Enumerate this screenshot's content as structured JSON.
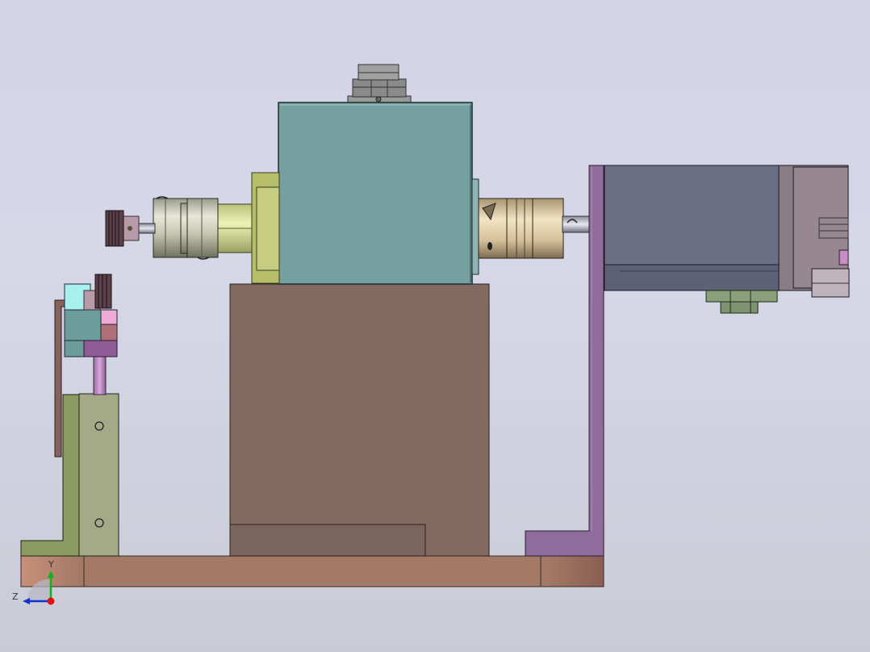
{
  "app": {
    "title": ""
  },
  "viewport": {
    "background_top": "#d2d4e6",
    "background_bottom": "#c9cbd6"
  },
  "triad": {
    "y_label": "Y",
    "z_label": "Z",
    "x_color": "#e01010",
    "y_color": "#10b020",
    "z_color": "#1030d0"
  },
  "colors": {
    "base_plate": "#a27c68",
    "pedestal": "#826a60",
    "housing": "#76a0a0",
    "motor": "#6c6e84",
    "bracket": "#906c9c",
    "sensor_bracket": "#8a9a60",
    "coupling": "#d6d4b8"
  },
  "components": [
    "base-plate",
    "pedestal",
    "spindle-housing",
    "top-connector",
    "left-flange",
    "left-shaft-coupling",
    "knurled-knob",
    "right-shaft-coupling",
    "motor-bracket",
    "servo-motor",
    "motor-connector",
    "sensor-stand",
    "sensor-head"
  ]
}
